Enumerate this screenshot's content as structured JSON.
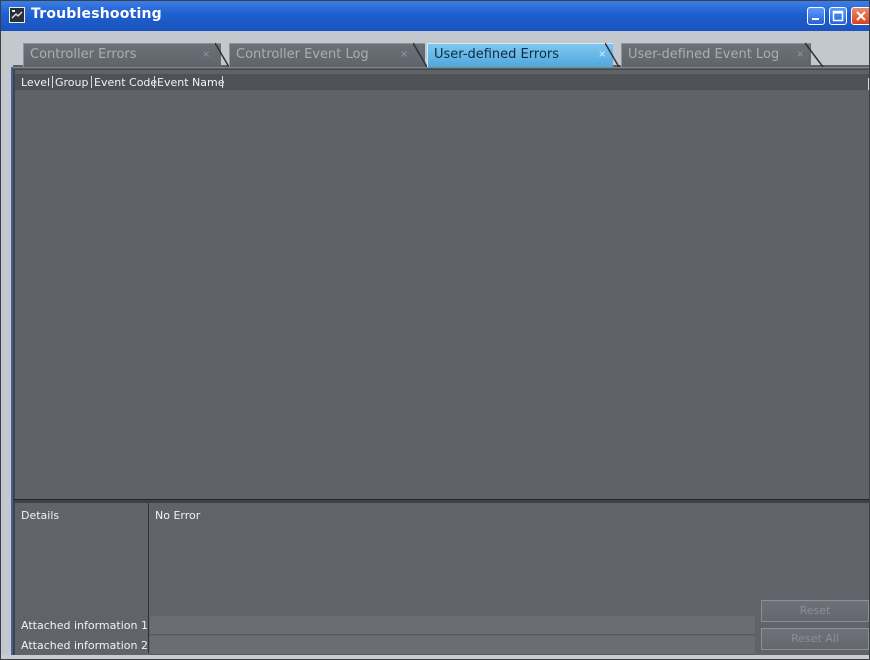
{
  "window": {
    "title": "Troubleshooting",
    "colors": {
      "titlebar": "#1f5fcf",
      "active_tab": "#5bb4e5",
      "panel": "#5f6368"
    }
  },
  "tabs": [
    {
      "label": "Controller Errors",
      "close": "×",
      "active": false
    },
    {
      "label": "Controller Event Log",
      "close": "×",
      "active": false
    },
    {
      "label": "User-defined Errors",
      "close": "×",
      "active": true
    },
    {
      "label": "User-defined Event Log",
      "close": "×",
      "active": false
    }
  ],
  "list": {
    "columns": [
      "Level",
      "Group",
      "Event Code",
      "Event Name"
    ],
    "rows": []
  },
  "details": {
    "details_label": "Details",
    "details_value": "No Error",
    "attached_info_1_label": "Attached information 1",
    "attached_info_2_label": "Attached information 2",
    "attached_info_1_value": "",
    "attached_info_2_value": ""
  },
  "buttons": {
    "reset": "Reset",
    "reset_all": "Reset All"
  },
  "icons": {
    "app": "troubleshooting-window-icon",
    "minimize": "minimize-icon",
    "maximize": "maximize-icon",
    "close": "close-icon"
  }
}
